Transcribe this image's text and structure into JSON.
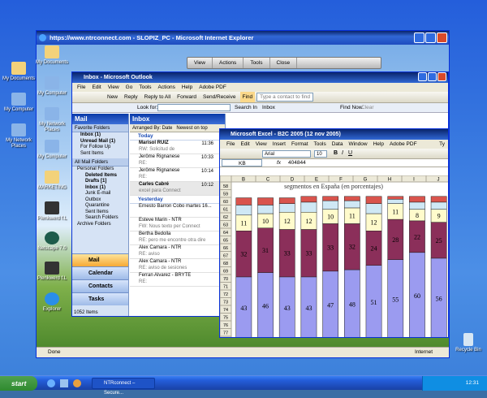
{
  "desktop": {
    "icons": [
      {
        "label": "My Documents"
      },
      {
        "label": "My Computer"
      },
      {
        "label": "My Network Places"
      },
      {
        "label": "Recycle Bin"
      }
    ],
    "inner_icons": [
      {
        "label": "My Documents"
      },
      {
        "label": "My Computer"
      },
      {
        "label": "My Network Places"
      },
      {
        "label": "My Computer"
      },
      {
        "label": "MARKETING"
      },
      {
        "label": "Plenkwerd f.L"
      },
      {
        "label": "Netscape 7.0"
      },
      {
        "label": "Plenkwerd f.L"
      },
      {
        "label": "Explorer"
      }
    ]
  },
  "ie": {
    "title": "https://www.ntrconnect.com - SLOPIZ_PC - Microsoft Internet Explorer",
    "toolbar": [
      "View",
      "Actions",
      "Tools",
      "Close"
    ],
    "status_left": "Done",
    "status_right": "Internet"
  },
  "outlook": {
    "title": "Inbox - Microsoft Outlook",
    "menu": [
      "File",
      "Edit",
      "View",
      "Go",
      "Tools",
      "Actions",
      "Help",
      "Adobe PDF"
    ],
    "toolbar": [
      "New",
      "Reply",
      "Reply to All",
      "Forward",
      "Send/Receive",
      "Find"
    ],
    "search_hint": "Type a contact to find",
    "look_for_label": "Look for:",
    "search_in_label": "Search In",
    "search_in_value": "Inbox",
    "find_now": "Find Now",
    "clear": "Clear",
    "nav": {
      "header": "Mail",
      "favorites_title": "Favorite Folders",
      "favorites": [
        "Inbox (1)",
        "Unread Mail (1)",
        "For Follow Up",
        "Sent Items"
      ],
      "all_title": "All Mail Folders",
      "folders": [
        "Personal Folders",
        "Deleted Items",
        "Drafts [1]",
        "Inbox (1)",
        "Junk E-mail",
        "Outbox",
        "Quarantine",
        "Sent Items",
        "Search Folders",
        "Archive Folders"
      ],
      "buttons": [
        "Mail",
        "Calendar",
        "Contacts",
        "Tasks"
      ],
      "items_count": "1052 Items"
    },
    "inbox": {
      "header": "Inbox",
      "arranged": "Arranged By: Date",
      "order": "Newest on top",
      "group_today": "Today",
      "group_yesterday": "Yesterday",
      "today": [
        {
          "from": "Marisol RUIZ",
          "subject": "RW: Solicitud de",
          "time": "11:36"
        },
        {
          "from": "Jerôme Rignanese",
          "subject": "RE:",
          "time": "10:33"
        },
        {
          "from": "Jerôme Rignanese",
          "subject": "RE:",
          "time": "10:14"
        },
        {
          "from": "Carles Cabré",
          "subject": "excel para Connect",
          "time": "10:12"
        }
      ],
      "yesterday": [
        {
          "from": "Ernesto Barron Cobo martes 16...",
          "subject": ""
        },
        {
          "from": "Esteve Marin - NTR",
          "subject": "FW: Nous texto per Connect"
        },
        {
          "from": "Bertha Bedolla",
          "subject": "RE: pero me encontre otra dire"
        },
        {
          "from": "Alex Camara - NTR",
          "subject": "RE: aviso"
        },
        {
          "from": "Alex Camara - NTR",
          "subject": "RE: aviso de sesiones"
        },
        {
          "from": "Ferran Alvarez - BRYTE",
          "subject": "RE:"
        }
      ]
    }
  },
  "excel": {
    "title": "Microsoft Excel - B2C 2005 (12 nov 2005)",
    "menu": [
      "File",
      "Edit",
      "View",
      "Insert",
      "Format",
      "Tools",
      "Data",
      "Window",
      "Help",
      "Adobe PDF"
    ],
    "type_question": "Ty",
    "font": "Arial",
    "font_size": "10",
    "name_box": "KB",
    "formula": "404844",
    "columns": [
      "B",
      "C",
      "D",
      "E",
      "F",
      "G",
      "H",
      "I",
      "J"
    ],
    "rows": [
      "58",
      "59",
      "60",
      "61",
      "62",
      "63",
      "64",
      "65",
      "66",
      "67",
      "68",
      "69",
      "70",
      "71",
      "72",
      "73",
      "74",
      "75",
      "76",
      "77",
      "78"
    ],
    "chart_title": "segmentos en España (en porcentajes)"
  },
  "chart_data": {
    "type": "bar",
    "stacked": true,
    "title": "segmentos en España (en porcentajes)",
    "series": [
      {
        "name": "",
        "values": [
          43,
          46,
          43,
          43,
          47,
          48,
          51,
          55,
          60,
          56
        ]
      },
      {
        "name": "",
        "values": [
          32,
          31,
          33,
          33,
          33,
          32,
          24,
          28,
          22,
          25
        ]
      },
      {
        "name": "",
        "values": [
          11,
          10,
          12,
          12,
          10,
          11,
          12,
          11,
          8,
          9
        ]
      },
      {
        "name": "",
        "values": [
          7,
          6,
          6,
          7,
          6,
          5,
          7,
          3,
          5,
          5
        ]
      },
      {
        "name": "",
        "values": [
          5,
          5,
          4,
          4,
          3,
          3,
          5,
          2,
          4,
          4
        ]
      }
    ],
    "colors": [
      "#9b9bf0",
      "#8b2f5a",
      "#fffbcc",
      "#cfe8f5",
      "#d9544d"
    ]
  },
  "taskbar": {
    "start": "start",
    "task": "NTRconnect – Secure...",
    "clock": "12:31"
  }
}
